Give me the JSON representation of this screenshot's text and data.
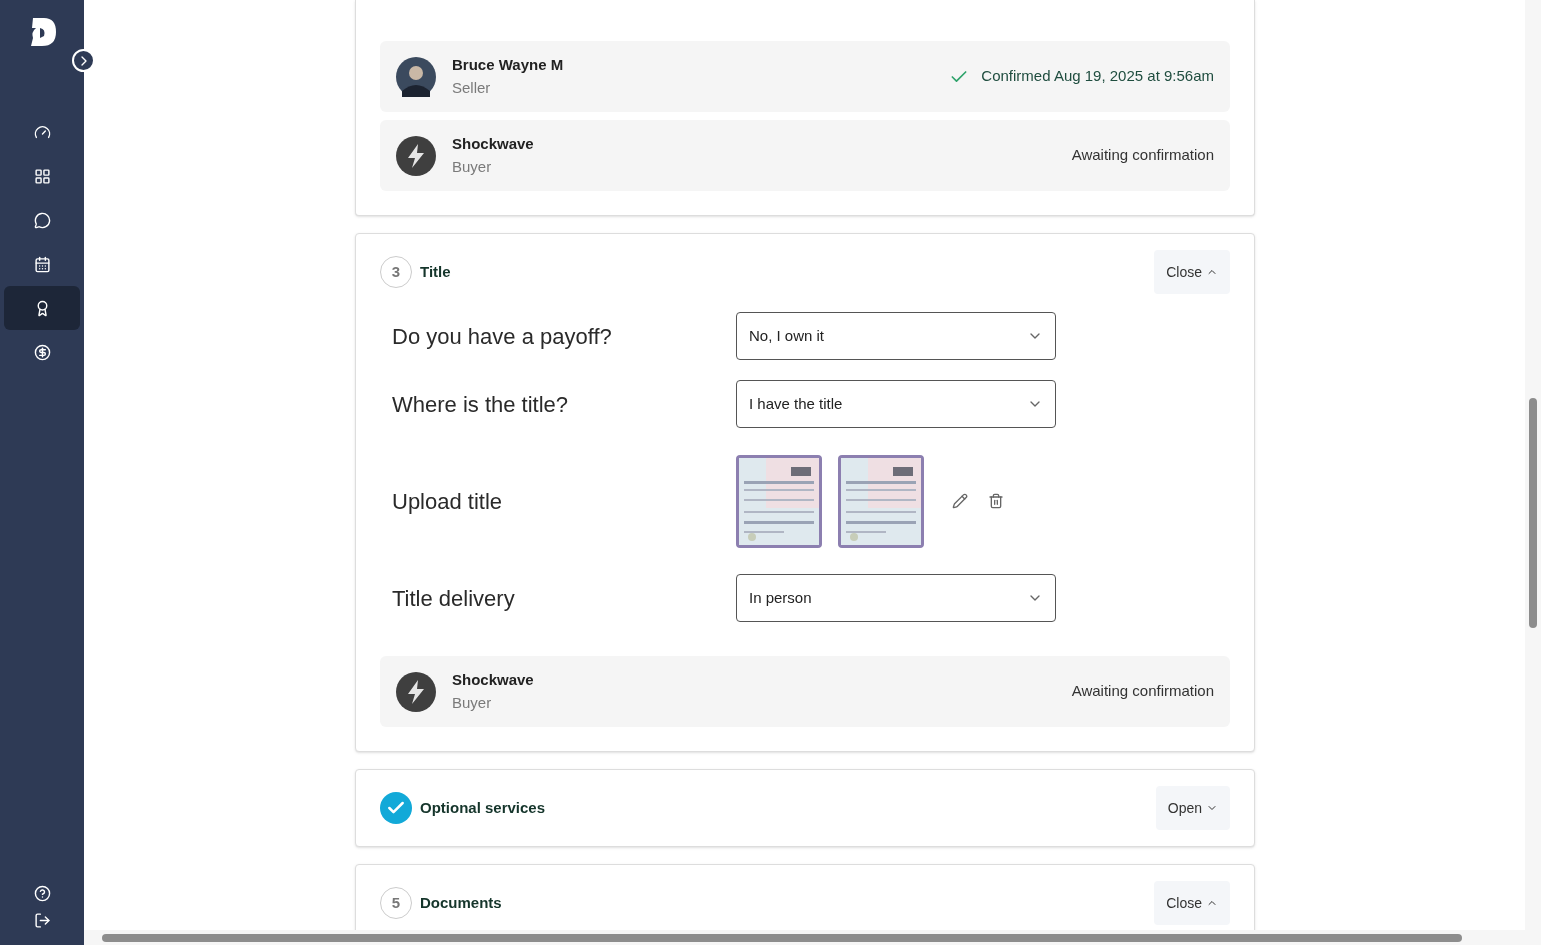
{
  "sidebar": {
    "nav_items": [
      {
        "selected": false
      },
      {
        "selected": false
      },
      {
        "selected": false
      },
      {
        "selected": false
      },
      {
        "selected": true
      },
      {
        "selected": false
      }
    ],
    "footer_items": [
      {
        "kind": "help"
      },
      {
        "kind": "logout"
      }
    ]
  },
  "sections": [
    {
      "kind": "parties",
      "parties": [
        {
          "name": "Bruce Wayne M",
          "role": "Seller",
          "confirmed": true,
          "status": "Confirmed Aug 19, 2025 at 9:56am"
        },
        {
          "name": "Shockwave",
          "role": "Buyer",
          "avatar": {
            "kind": "logo"
          },
          "confirmed": false,
          "status": "Awaiting confirmation"
        }
      ]
    },
    {
      "kind": "step",
      "step": "3",
      "done": false,
      "title": "Title",
      "toggle": "Close",
      "expanded": true,
      "fields": [
        {
          "kind": "select",
          "label": "Do you have a payoff?",
          "value": "No, I own it"
        },
        {
          "kind": "select",
          "label": "Where is the title?",
          "value": "I have the title"
        },
        {
          "kind": "upload",
          "label": "Upload title"
        },
        {
          "kind": "select",
          "label": "Title delivery",
          "value": "In person"
        }
      ],
      "parties": [
        {
          "name": "Shockwave",
          "role": "Buyer",
          "avatar": {
            "kind": "logo"
          },
          "confirmed": false,
          "status": "Awaiting confirmation"
        }
      ]
    },
    {
      "kind": "step",
      "done": true,
      "title": "Optional services",
      "toggle": "Open",
      "expanded": false
    },
    {
      "kind": "step",
      "step": "5",
      "done": false,
      "title": "Documents",
      "toggle": "Close",
      "expanded": true
    }
  ]
}
